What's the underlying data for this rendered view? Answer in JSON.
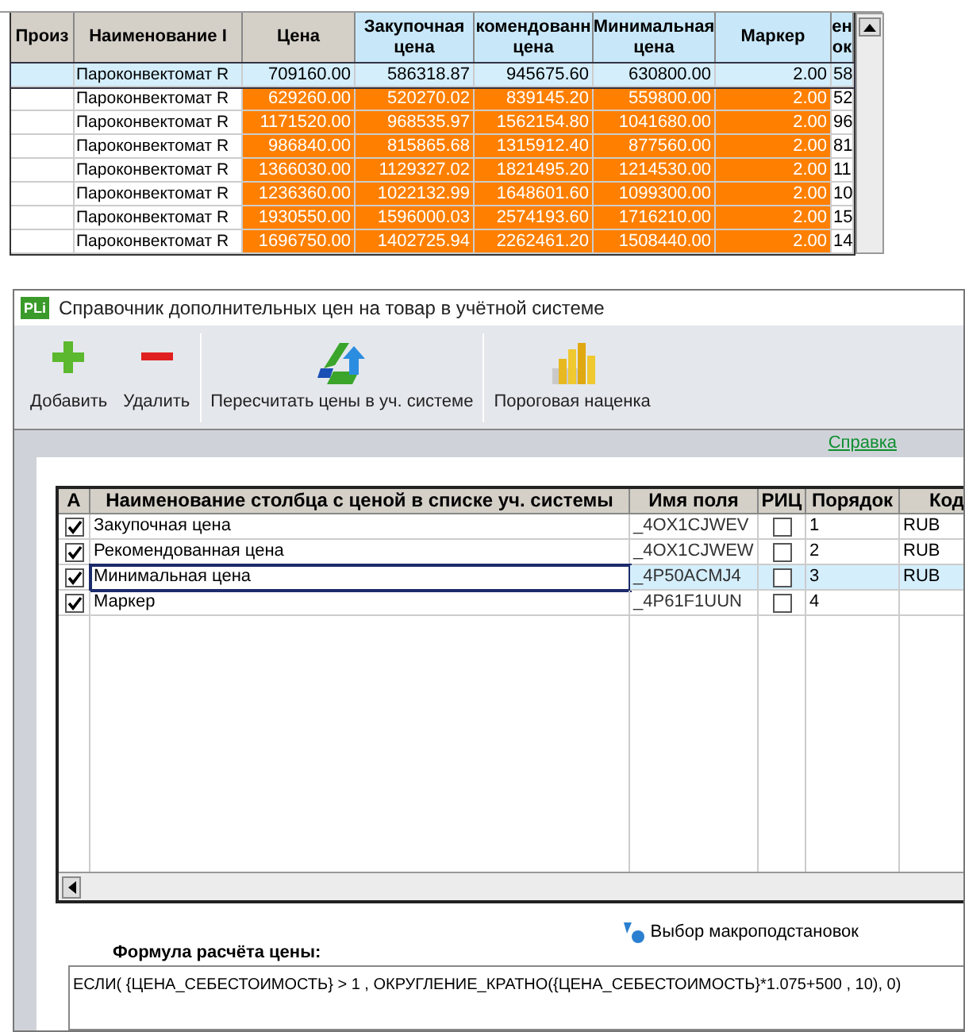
{
  "background_table": {
    "columns": [
      "Произ",
      "Наименование I",
      "Цена",
      "Закупочная цена",
      "комендованн цена",
      "Минимальная цена",
      "Маркер",
      "ен ок"
    ],
    "rows": [
      {
        "selected": true,
        "cells": [
          "",
          "Пароконвектомат R",
          "709160.00",
          "586318.87",
          "945675.60",
          "630800.00",
          "2.00",
          "58"
        ]
      },
      {
        "selected": false,
        "cells": [
          "",
          "Пароконвектомат R",
          "629260.00",
          "520270.02",
          "839145.20",
          "559800.00",
          "2.00",
          "52"
        ]
      },
      {
        "selected": false,
        "cells": [
          "",
          "Пароконвектомат R",
          "1171520.00",
          "968535.97",
          "1562154.80",
          "1041680.00",
          "2.00",
          "96"
        ]
      },
      {
        "selected": false,
        "cells": [
          "",
          "Пароконвектомат R",
          "986840.00",
          "815865.68",
          "1315912.40",
          "877560.00",
          "2.00",
          "81"
        ]
      },
      {
        "selected": false,
        "cells": [
          "",
          "Пароконвектомат R",
          "1366030.00",
          "1129327.02",
          "1821495.20",
          "1214530.00",
          "2.00",
          "11"
        ]
      },
      {
        "selected": false,
        "cells": [
          "",
          "Пароконвектомат R",
          "1236360.00",
          "1022132.99",
          "1648601.60",
          "1099300.00",
          "2.00",
          "10"
        ]
      },
      {
        "selected": false,
        "cells": [
          "",
          "Пароконвектомат R",
          "1930550.00",
          "1596000.03",
          "2574193.60",
          "1716210.00",
          "2.00",
          "15"
        ]
      },
      {
        "selected": false,
        "cells": [
          "",
          "Пароконвектомат R",
          "1696750.00",
          "1402725.94",
          "2262461.20",
          "1508440.00",
          "2.00",
          "14"
        ]
      }
    ]
  },
  "dialog": {
    "logo": "PLi",
    "title": "Справочник дополнительных цен на товар в учётной системе",
    "toolbar": [
      {
        "kind": "add",
        "label": "Добавить"
      },
      {
        "kind": "remove",
        "label": "Удалить"
      },
      {
        "kind": "recalc",
        "label": "Пересчитать цены в уч. системе"
      },
      {
        "kind": "markup",
        "label": "Пороговая наценка"
      }
    ],
    "help_link": "Справка",
    "price_columns": {
      "columns": [
        "А",
        "Наименование столбца с ценой в списке уч. системы",
        "Имя поля",
        "РИЦ",
        "Порядок",
        "Код"
      ],
      "rows": [
        {
          "selected": false,
          "active": true,
          "name": "Закупочная цена",
          "field": "_4OX1CJWEV",
          "flag": false,
          "order": "1",
          "code": "RUB"
        },
        {
          "selected": false,
          "active": true,
          "name": "Рекомендованная цена",
          "field": "_4OX1CJWEW",
          "flag": false,
          "order": "2",
          "code": "RUB"
        },
        {
          "selected": true,
          "active": true,
          "name": "Минимальная цена",
          "field": "_4P50ACMJ4",
          "flag": false,
          "order": "3",
          "code": "RUB"
        },
        {
          "selected": false,
          "active": true,
          "name": "Маркер",
          "field": "_4P61F1UUN",
          "flag": false,
          "order": "4"
        }
      ]
    },
    "macro_button": "Выбор макроподстановок",
    "formula_label": "Формула расчёта цены:",
    "formula": "ЕСЛИ( {ЦЕНА_СЕБЕСТОИМОСТЬ} > 1 , ОКРУГЛЕНИЕ_КРАТНО({ЦЕНА_СЕБЕСТОИМОСТЬ}*1.075+500 , 10), 0)"
  }
}
